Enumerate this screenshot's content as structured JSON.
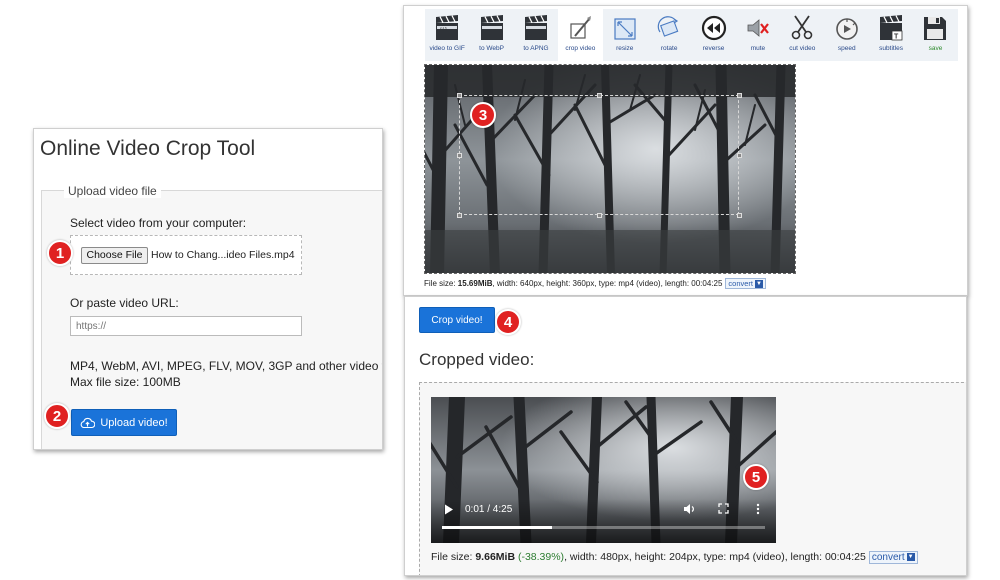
{
  "upload_panel": {
    "title": "Online Video Crop Tool",
    "legend": "Upload video file",
    "select_label": "Select video from your computer:",
    "choose_file_label": "Choose File",
    "file_name": "How to Chang...ideo Files.mp4",
    "url_label": "Or paste video URL:",
    "url_placeholder": "https://",
    "formats_text": "MP4, WebM, AVI, MPEG, FLV, MOV, 3GP and other video files",
    "max_size_text": "Max file size: 100MB",
    "upload_button_label": "Upload video!"
  },
  "markers": {
    "m1": "1",
    "m2": "2",
    "m3": "3",
    "m4": "4",
    "m5": "5"
  },
  "toolbar": {
    "items": [
      {
        "label": "video to GIF",
        "icon": "clapperboard-icon"
      },
      {
        "label": "to WebP",
        "icon": "clapperboard-icon"
      },
      {
        "label": "to APNG",
        "icon": "clapperboard-icon"
      },
      {
        "label": "crop video",
        "icon": "crop-icon"
      },
      {
        "label": "resize",
        "icon": "resize-icon"
      },
      {
        "label": "rotate",
        "icon": "rotate-icon"
      },
      {
        "label": "reverse",
        "icon": "reverse-icon"
      },
      {
        "label": "mute",
        "icon": "mute-icon"
      },
      {
        "label": "cut video",
        "icon": "scissors-icon"
      },
      {
        "label": "speed",
        "icon": "speed-icon"
      },
      {
        "label": "subtitles",
        "icon": "subtitles-icon"
      },
      {
        "label": "save",
        "icon": "save-icon"
      }
    ],
    "active": "crop video"
  },
  "source_info": {
    "prefix": "File size: ",
    "size": "15.69MiB",
    "details": ", width: 640px, height: 360px, type: mp4 (video), length: 00:04:25",
    "convert_label": "convert"
  },
  "result_panel": {
    "crop_button_label": "Crop video!",
    "title": "Cropped video:",
    "player": {
      "time": "0:01 / 4:25",
      "progress": 0.34
    },
    "file_info": {
      "prefix": "File size: ",
      "size": "9.66MiB",
      "change": "(-38.39%)",
      "details": ", width: 480px, height: 204px, type: mp4 (video), length: 00:04:25",
      "convert_label": "convert"
    }
  },
  "colors": {
    "accent_blue": "#1a73d9",
    "marker_red": "#e02121",
    "toolbar_bg": "#eef2f6"
  }
}
